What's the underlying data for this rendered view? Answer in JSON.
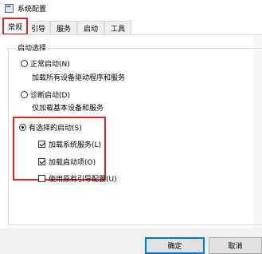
{
  "window": {
    "title": "系统配置"
  },
  "tabs": [
    {
      "label": "常规",
      "active": true
    },
    {
      "label": "引导",
      "active": false
    },
    {
      "label": "服务",
      "active": false
    },
    {
      "label": "启动",
      "active": false
    },
    {
      "label": "工具",
      "active": false
    }
  ],
  "startup_selection": {
    "group_label": "启动选择",
    "normal": {
      "label": "正常启动(N)",
      "description": "加载所有设备驱动程序和服务",
      "selected": false
    },
    "diagnostic": {
      "label": "诊断启动(D)",
      "description": "仅加载基本设备和服务",
      "selected": false
    },
    "selective": {
      "label": "有选择的启动(S)",
      "selected": true,
      "options": [
        {
          "label": "加载系统服务(L)",
          "checked": true
        },
        {
          "label": "加载启动项(O)",
          "checked": true
        },
        {
          "label": "使用原有引导配置(U)",
          "checked": false
        }
      ]
    }
  },
  "buttons": {
    "ok": "确定",
    "cancel": "取消"
  },
  "colors": {
    "highlight": "#e0241f",
    "default_button_border": "#0078d7"
  }
}
